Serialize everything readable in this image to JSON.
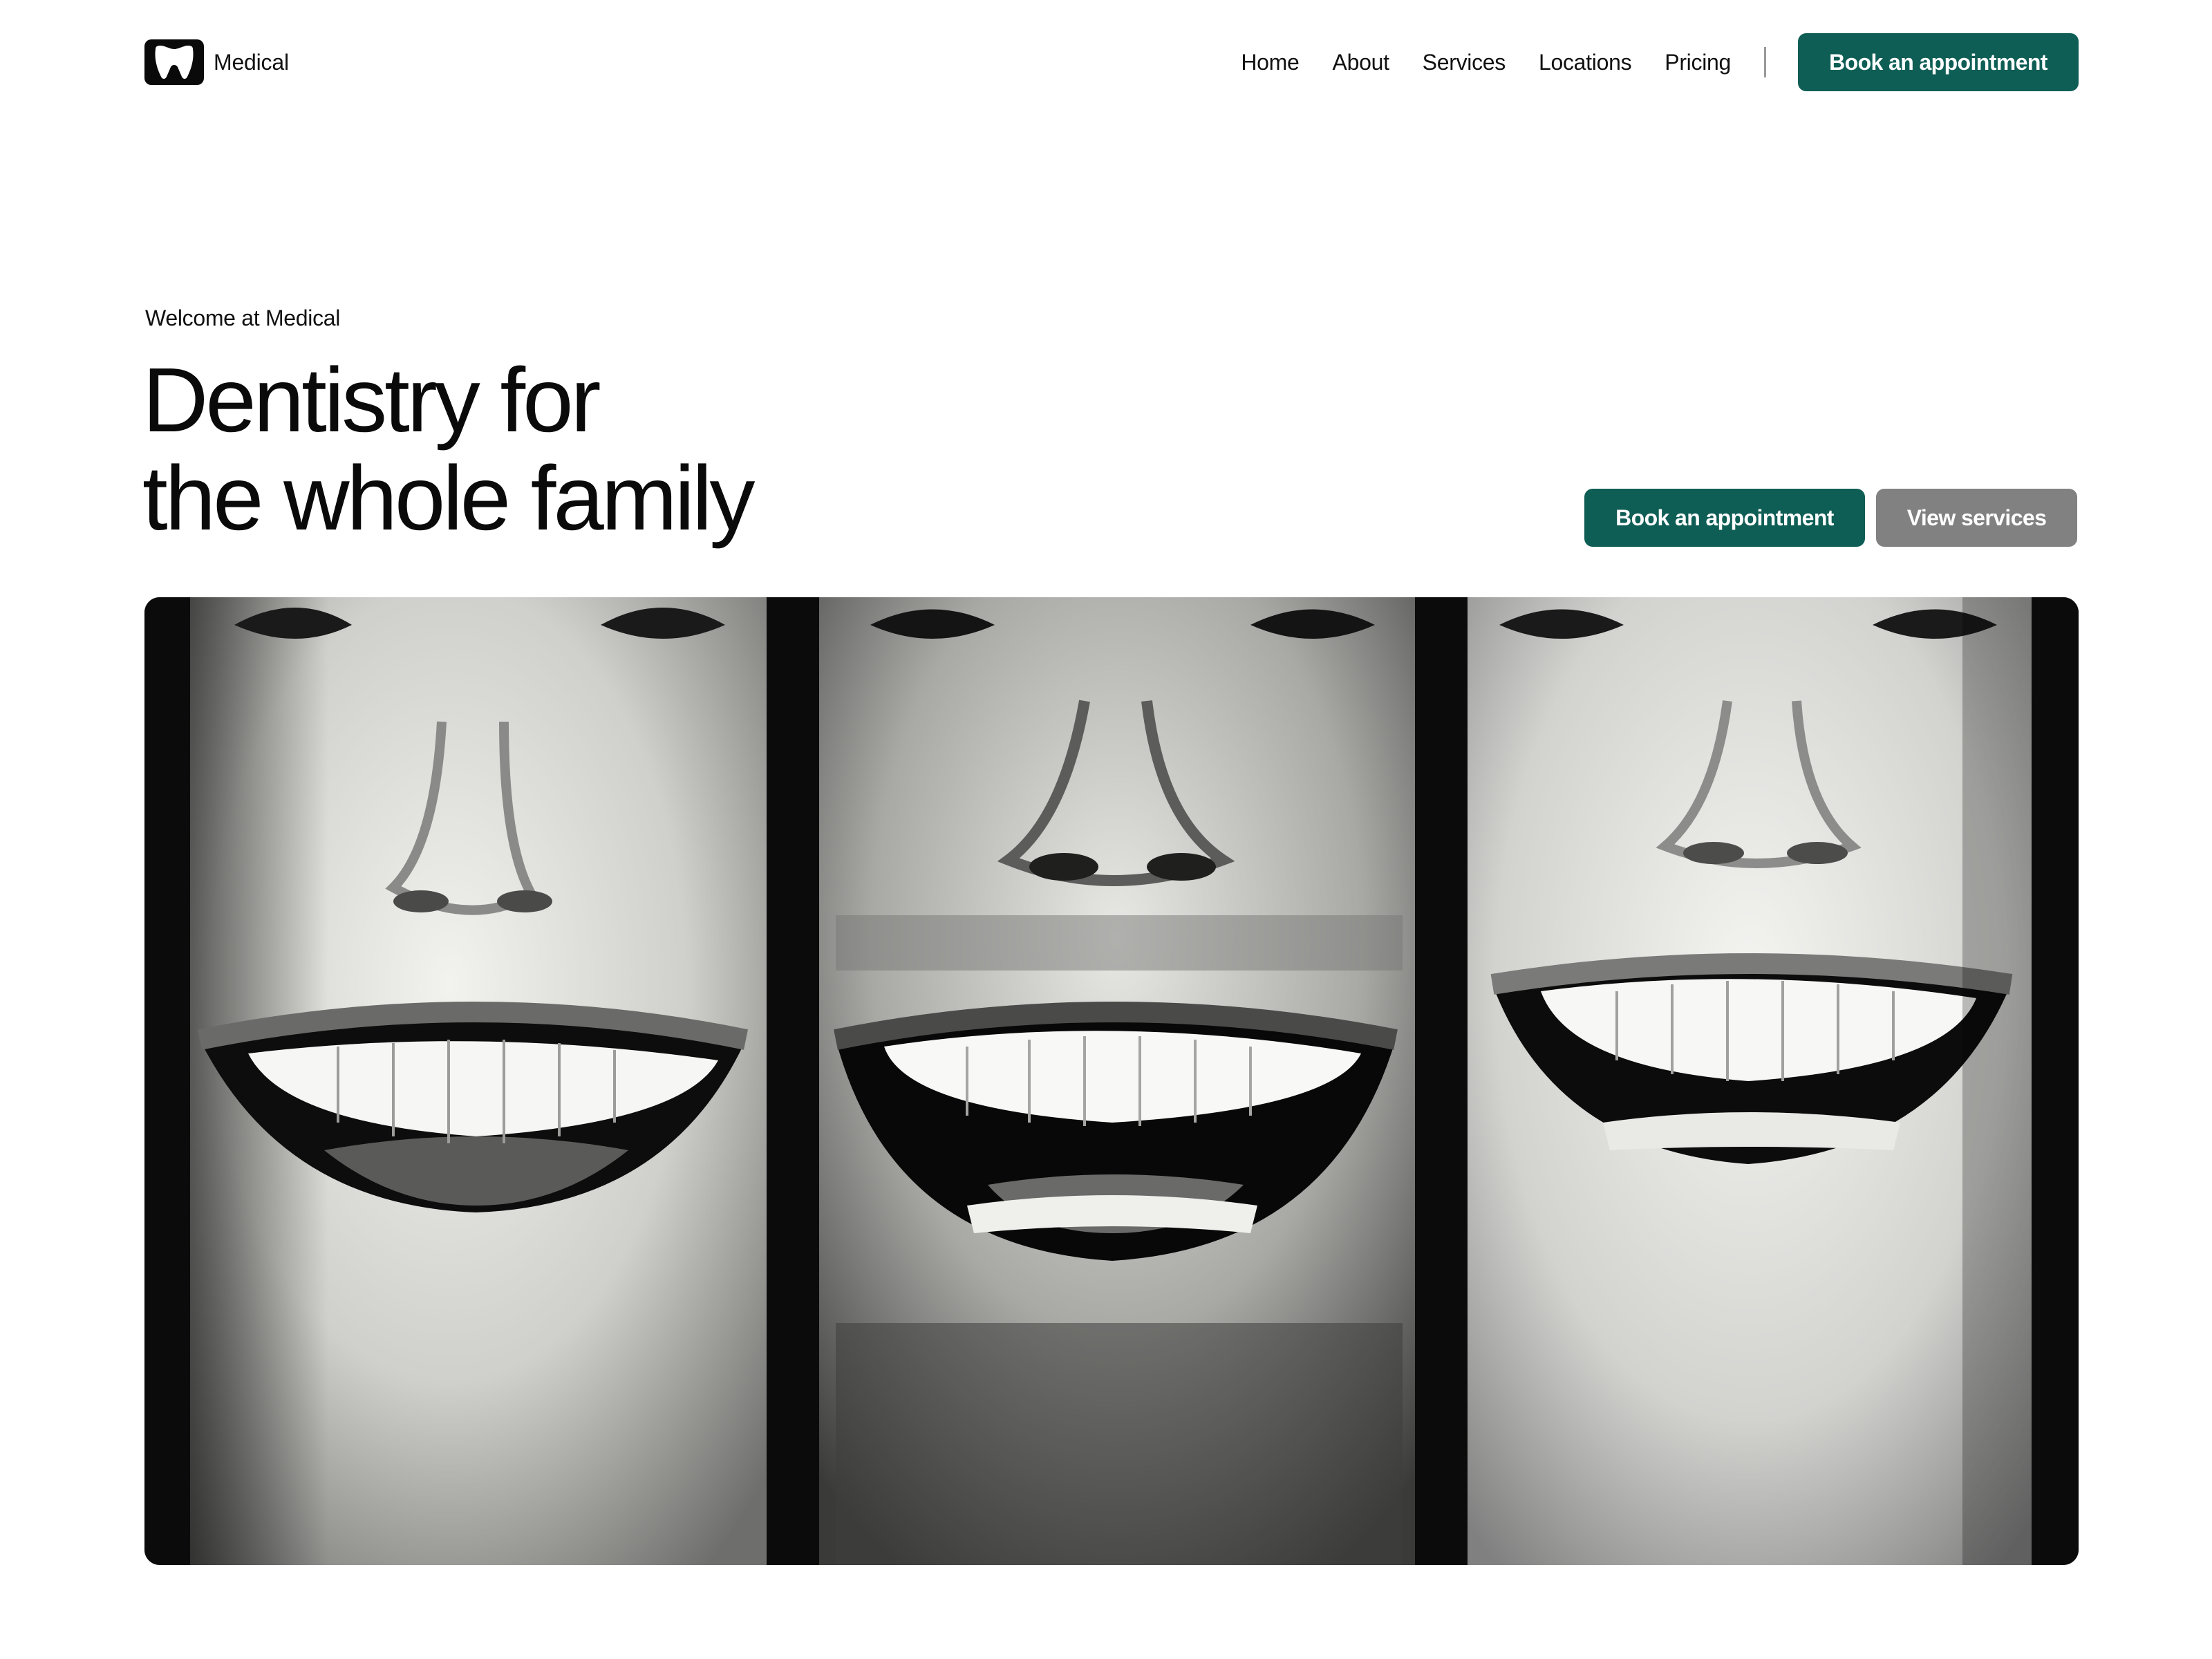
{
  "brand": {
    "name": "Medical",
    "logo_icon": "tooth-logo-icon"
  },
  "nav": {
    "items": [
      {
        "label": "Home"
      },
      {
        "label": "About"
      },
      {
        "label": "Services"
      },
      {
        "label": "Locations"
      },
      {
        "label": "Pricing"
      }
    ],
    "cta_label": "Book an appointment"
  },
  "hero": {
    "eyebrow": "Welcome at Medical",
    "headline_line1": "Dentistry for",
    "headline_line2": "the whole family",
    "primary_label": "Book an appointment",
    "secondary_label": "View services"
  },
  "colors": {
    "accent": "#0e5e55",
    "secondary_button": "#818181",
    "text": "#0d0d0d",
    "background": "#ffffff"
  }
}
